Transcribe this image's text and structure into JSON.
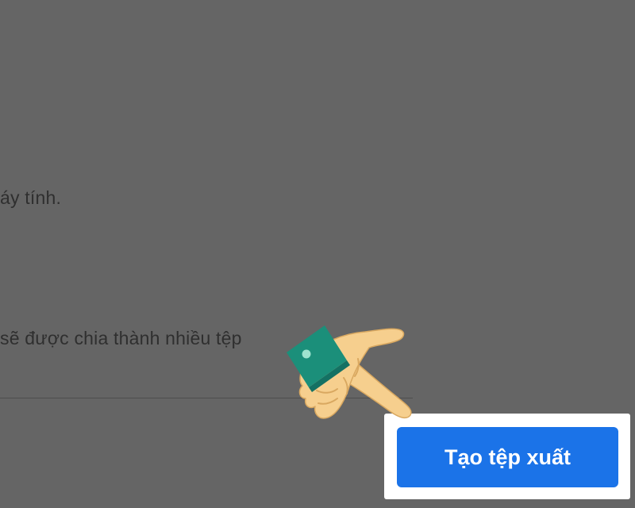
{
  "content": {
    "line1_text": "áy tính.",
    "line2_text": "sẽ được chia thành nhiều tệp"
  },
  "export_button": {
    "label": "Tạo tệp xuất"
  },
  "overlay": {
    "pointer_icon": "pointing-hand-icon"
  },
  "colors": {
    "backdrop": "#656565",
    "button_bg": "#1b73e8",
    "button_text": "#ffffff",
    "highlight": "#ffffff",
    "cuff": "#1b8f7a",
    "skin": "#f6cf8e"
  }
}
